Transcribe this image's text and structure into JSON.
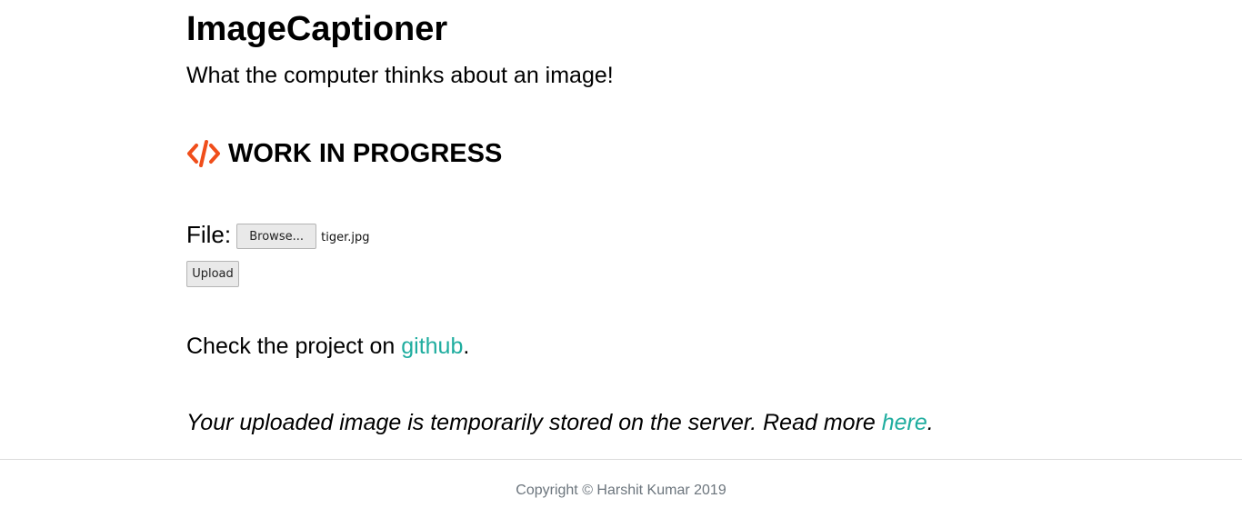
{
  "header": {
    "title": "ImageCaptioner",
    "subtitle": "What the computer thinks about an image!"
  },
  "banner": {
    "icon": "code-icon",
    "icon_color": "#f04e1b",
    "text": "WORK IN PROGRESS"
  },
  "form": {
    "file_label": "File:",
    "browse_label": "Browse...",
    "selected_file": "tiger.jpg",
    "upload_label": "Upload"
  },
  "github_line": {
    "prefix": "Check the project on ",
    "link_text": "github",
    "suffix": "."
  },
  "note_line": {
    "prefix": "Your uploaded image is temporarily stored on the server. Read more ",
    "link_text": "here",
    "suffix": "."
  },
  "footer": {
    "copyright": "Copyright © Harshit Kumar 2019"
  },
  "colors": {
    "link": "#1fad9f",
    "footer_text": "#6c757d",
    "accent": "#f04e1b"
  }
}
